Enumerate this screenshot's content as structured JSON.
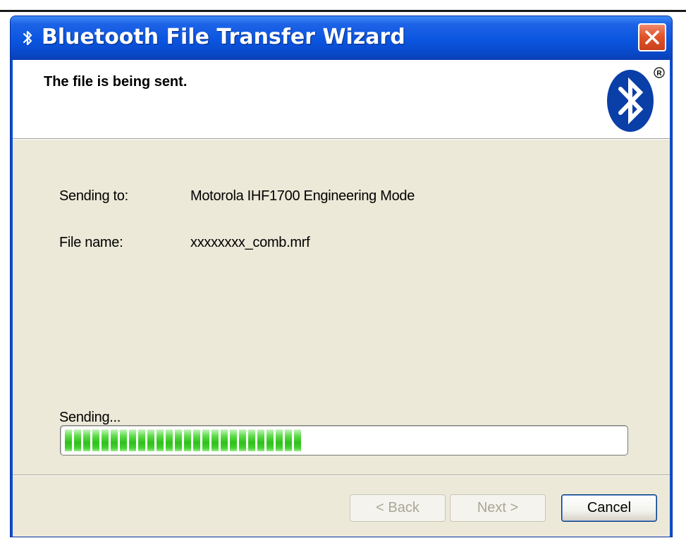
{
  "window": {
    "title": "Bluetooth File Transfer Wizard",
    "title_icon": "bluetooth-icon",
    "close_icon": "close-icon"
  },
  "header": {
    "title": "The file is being sent.",
    "logo": "bluetooth-logo-icon"
  },
  "details": {
    "sending_to_label": "Sending to:",
    "sending_to_value": "Motorola IHF1700 Engineering Mode",
    "file_name_label": "File name:",
    "file_name_value": "xxxxxxxx_comb.mrf"
  },
  "progress": {
    "label": "Sending...",
    "fraction": 0.43
  },
  "buttons": {
    "back": "< Back",
    "next": "Next >",
    "cancel": "Cancel"
  },
  "colors": {
    "titlebar": "#0a55e0",
    "client_bg": "#ece9d8",
    "progress_green": "#2fc01c",
    "close_red": "#e0552c",
    "bluetooth_blue": "#0a3fa8"
  }
}
